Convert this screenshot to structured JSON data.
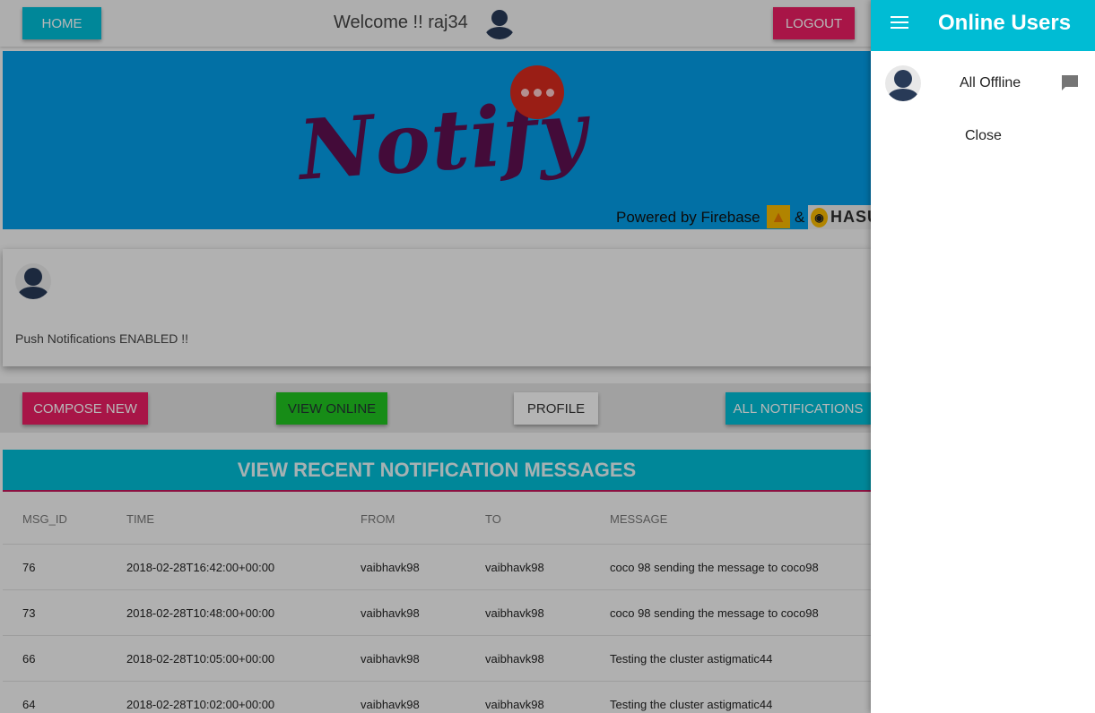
{
  "header": {
    "home_label": "HOME",
    "welcome_text": "Welcome !! raj34",
    "logout_label": "LOGOUT"
  },
  "banner": {
    "logo_text": "Notify",
    "powered_text": "Powered by Firebase",
    "amp": "&",
    "hasura_text": "HASU"
  },
  "profile_card": {
    "status_text": "Push Notifications ENABLED !!"
  },
  "actions": {
    "compose_label": "COMPOSE NEW",
    "view_online_label": "VIEW ONLINE",
    "profile_label": "PROFILE",
    "all_notifications_label": "ALL NOTIFICATIONS"
  },
  "messages": {
    "title": "VIEW RECENT NOTIFICATION MESSAGES",
    "columns": [
      "MSG_ID",
      "TIME",
      "FROM",
      "TO",
      "MESSAGE"
    ],
    "rows": [
      [
        "76",
        "2018-02-28T16:42:00+00:00",
        "vaibhavk98",
        "vaibhavk98",
        "coco 98 sending the message to coco98"
      ],
      [
        "73",
        "2018-02-28T10:48:00+00:00",
        "vaibhavk98",
        "vaibhavk98",
        "coco 98 sending the message to coco98"
      ],
      [
        "66",
        "2018-02-28T10:05:00+00:00",
        "vaibhavk98",
        "vaibhavk98",
        "Testing the cluster astigmatic44"
      ],
      [
        "64",
        "2018-02-28T10:02:00+00:00",
        "vaibhavk98",
        "vaibhavk98",
        "Testing the cluster astigmatic44"
      ]
    ]
  },
  "drawer": {
    "title": "Online Users",
    "user_status": "All Offline",
    "close_label": "Close"
  },
  "colors": {
    "cyan": "#00bcd4",
    "pink": "#e91e63",
    "green": "#21c321",
    "banner_blue": "#039be5"
  },
  "icons": [
    "menu-icon",
    "avatar-icon",
    "chat-icon",
    "dots-icon"
  ]
}
